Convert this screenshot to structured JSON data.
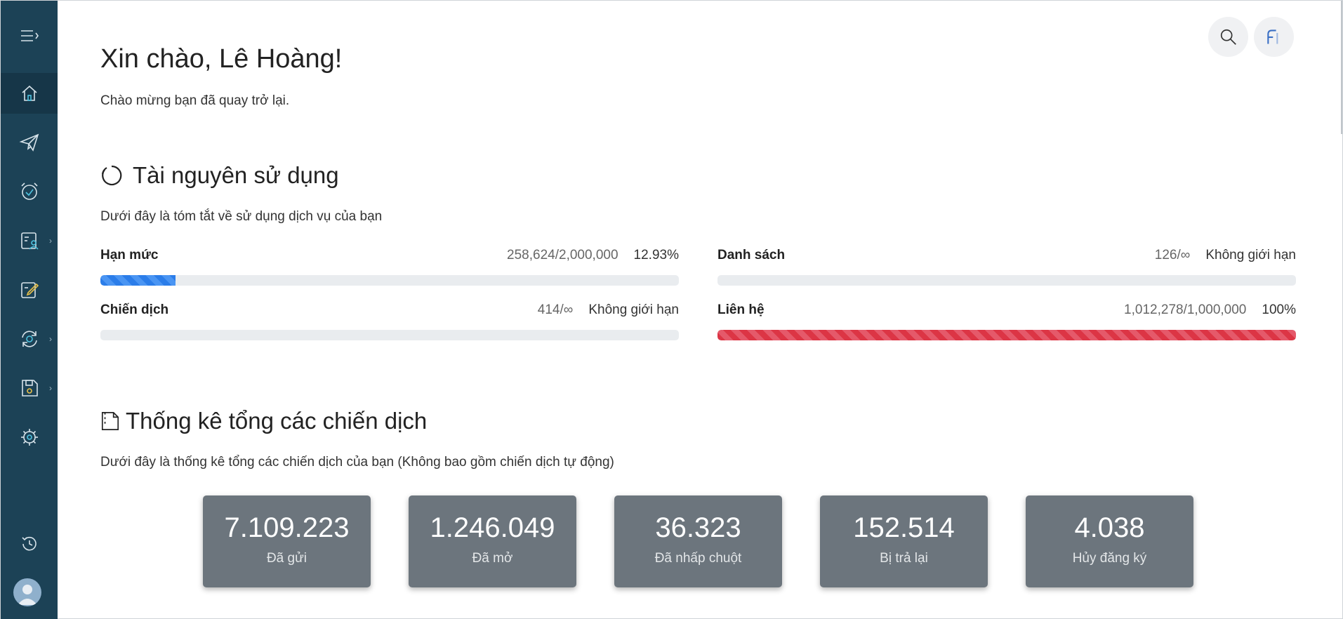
{
  "header": {
    "greeting": "Xin chào, Lê Hoàng!",
    "welcome": "Chào mừng bạn đã quay trở lại."
  },
  "sidebar": {
    "items": [
      {
        "icon": "home-icon",
        "active": true
      },
      {
        "icon": "paper-plane-icon"
      },
      {
        "icon": "alarm-clock-icon"
      },
      {
        "icon": "contacts-card-icon",
        "has_submenu": true
      },
      {
        "icon": "edit-note-icon"
      },
      {
        "icon": "sync-target-icon",
        "has_submenu": true
      },
      {
        "icon": "save-disk-icon",
        "has_submenu": true
      },
      {
        "icon": "gear-icon"
      },
      {
        "icon": "history-icon"
      }
    ]
  },
  "resources": {
    "title": "Tài nguyên sử dụng",
    "subtitle": "Dưới đây là tóm tắt về sử dụng dịch vụ của bạn",
    "items": [
      {
        "label": "Hạn mức",
        "value": "258,624/2,000,000",
        "percent": "12.93%",
        "fill": 0.1293,
        "color": "blue"
      },
      {
        "label": "Danh sách",
        "value": "126/∞",
        "percent": "Không giới hạn",
        "fill": 0,
        "color": "blue"
      },
      {
        "label": "Chiến dịch",
        "value": "414/∞",
        "percent": "Không giới hạn",
        "fill": 0,
        "color": "blue"
      },
      {
        "label": "Liên hệ",
        "value": "1,012,278/1,000,000",
        "percent": "100%",
        "fill": 1.0,
        "color": "red"
      }
    ]
  },
  "campaigns": {
    "title": "Thống kê tổng các chiến dịch",
    "subtitle": "Dưới đây là thống kê tổng các chiến dịch của bạn (Không bao gồm chiến dịch tự động)",
    "stats": [
      {
        "value": "7.109.223",
        "label": "Đã gửi"
      },
      {
        "value": "1.246.049",
        "label": "Đã mở"
      },
      {
        "value": "36.323",
        "label": "Đã nhấp chuột"
      },
      {
        "value": "152.514",
        "label": "Bị trả lại"
      },
      {
        "value": "4.038",
        "label": "Hủy đăng ký"
      }
    ]
  },
  "colors": {
    "sidebar": "#1c4256",
    "progress_blue": "#2b7de9",
    "progress_red": "#dc3545",
    "stat_card": "#6c757d"
  }
}
